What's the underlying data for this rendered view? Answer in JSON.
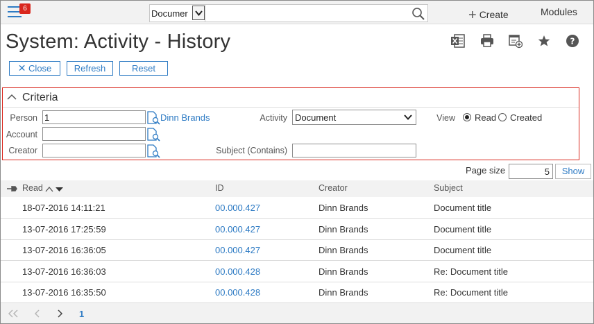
{
  "topbar": {
    "notification_count": "6",
    "search": {
      "selected_type": "Documer",
      "value": "",
      "placeholder": ""
    },
    "create_label": "Create",
    "modules_label": "Modules"
  },
  "page": {
    "title": "System: Activity - History",
    "toolbar_icons": [
      "excel-export-icon",
      "print-icon",
      "add-to-dashboard-icon",
      "favorite-star-icon",
      "help-icon"
    ]
  },
  "actions": {
    "close_label": "Close",
    "refresh_label": "Refresh",
    "reset_label": "Reset"
  },
  "criteria": {
    "title": "Criteria",
    "person_label": "Person",
    "person_value": "1",
    "person_link": "Dinn Brands",
    "account_label": "Account",
    "account_value": "",
    "creator_label": "Creator",
    "creator_value": "",
    "activity_label": "Activity",
    "activity_value": "Document",
    "subject_label": "Subject (Contains)",
    "subject_value": "",
    "view_label": "View",
    "view_options": [
      "Read",
      "Created"
    ],
    "view_selected": "Read"
  },
  "paging": {
    "page_size_label": "Page size",
    "page_size_value": "5",
    "show_label": "Show",
    "current_page": "1"
  },
  "grid": {
    "columns": [
      "Read",
      "ID",
      "Creator",
      "Subject"
    ],
    "rows": [
      {
        "read": "18-07-2016 14:11:21",
        "id": "00.000.427",
        "creator": "Dinn Brands",
        "subject": "Document title"
      },
      {
        "read": "13-07-2016 17:25:59",
        "id": "00.000.427",
        "creator": "Dinn Brands",
        "subject": "Document title"
      },
      {
        "read": "13-07-2016 16:36:05",
        "id": "00.000.427",
        "creator": "Dinn Brands",
        "subject": "Document title"
      },
      {
        "read": "13-07-2016 16:36:03",
        "id": "00.000.428",
        "creator": "Dinn Brands",
        "subject": "Re: Document title"
      },
      {
        "read": "13-07-2016 16:35:50",
        "id": "00.000.428",
        "creator": "Dinn Brands",
        "subject": "Re: Document title"
      }
    ]
  },
  "colors": {
    "accent": "#2e7bc4",
    "badge": "#d9261c",
    "criteria_border": "#d9261c",
    "header_bg": "#f2f2f2"
  }
}
